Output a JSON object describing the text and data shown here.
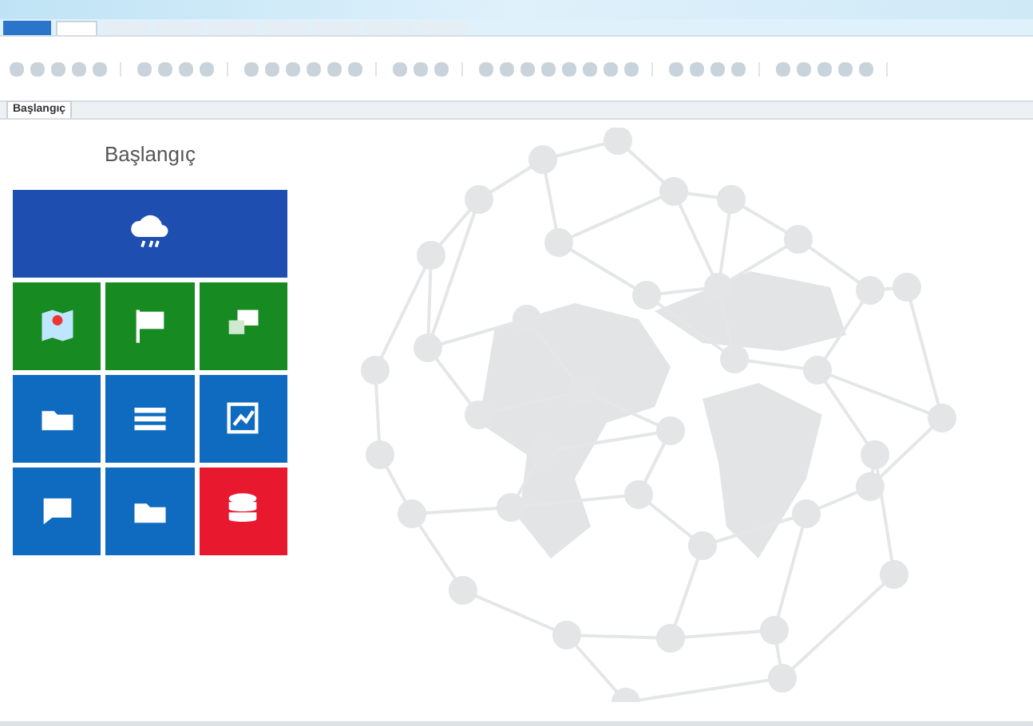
{
  "ribbon_tabs": [
    {
      "kind": "file",
      "selected": false
    },
    {
      "kind": "tab",
      "selected": true
    },
    {
      "kind": "tab",
      "selected": false
    },
    {
      "kind": "tab",
      "selected": false
    },
    {
      "kind": "tab",
      "selected": false
    },
    {
      "kind": "tab",
      "selected": false
    },
    {
      "kind": "tab",
      "selected": false
    },
    {
      "kind": "tab",
      "selected": false
    },
    {
      "kind": "tab",
      "selected": false
    }
  ],
  "document_tab": {
    "label": "Başlangıç",
    "selected": true
  },
  "heading": "Başlangıç",
  "tiles": [
    {
      "kind": "cloud",
      "color": "#1e4fb0",
      "wide": true
    },
    {
      "kind": "map",
      "color": "#178a22",
      "wide": false
    },
    {
      "kind": "flag",
      "color": "#178a22",
      "wide": false
    },
    {
      "kind": "flags",
      "color": "#178a22",
      "wide": false
    },
    {
      "kind": "folder",
      "color": "#0e6bc0",
      "wide": false
    },
    {
      "kind": "fence",
      "color": "#0e6bc0",
      "wide": false
    },
    {
      "kind": "chart",
      "color": "#0e6bc0",
      "wide": false
    },
    {
      "kind": "chat",
      "color": "#0e6bc0",
      "wide": false
    },
    {
      "kind": "folder",
      "color": "#0e6bc0",
      "wide": false
    },
    {
      "kind": "database",
      "color": "#e8182f",
      "wide": false
    }
  ]
}
